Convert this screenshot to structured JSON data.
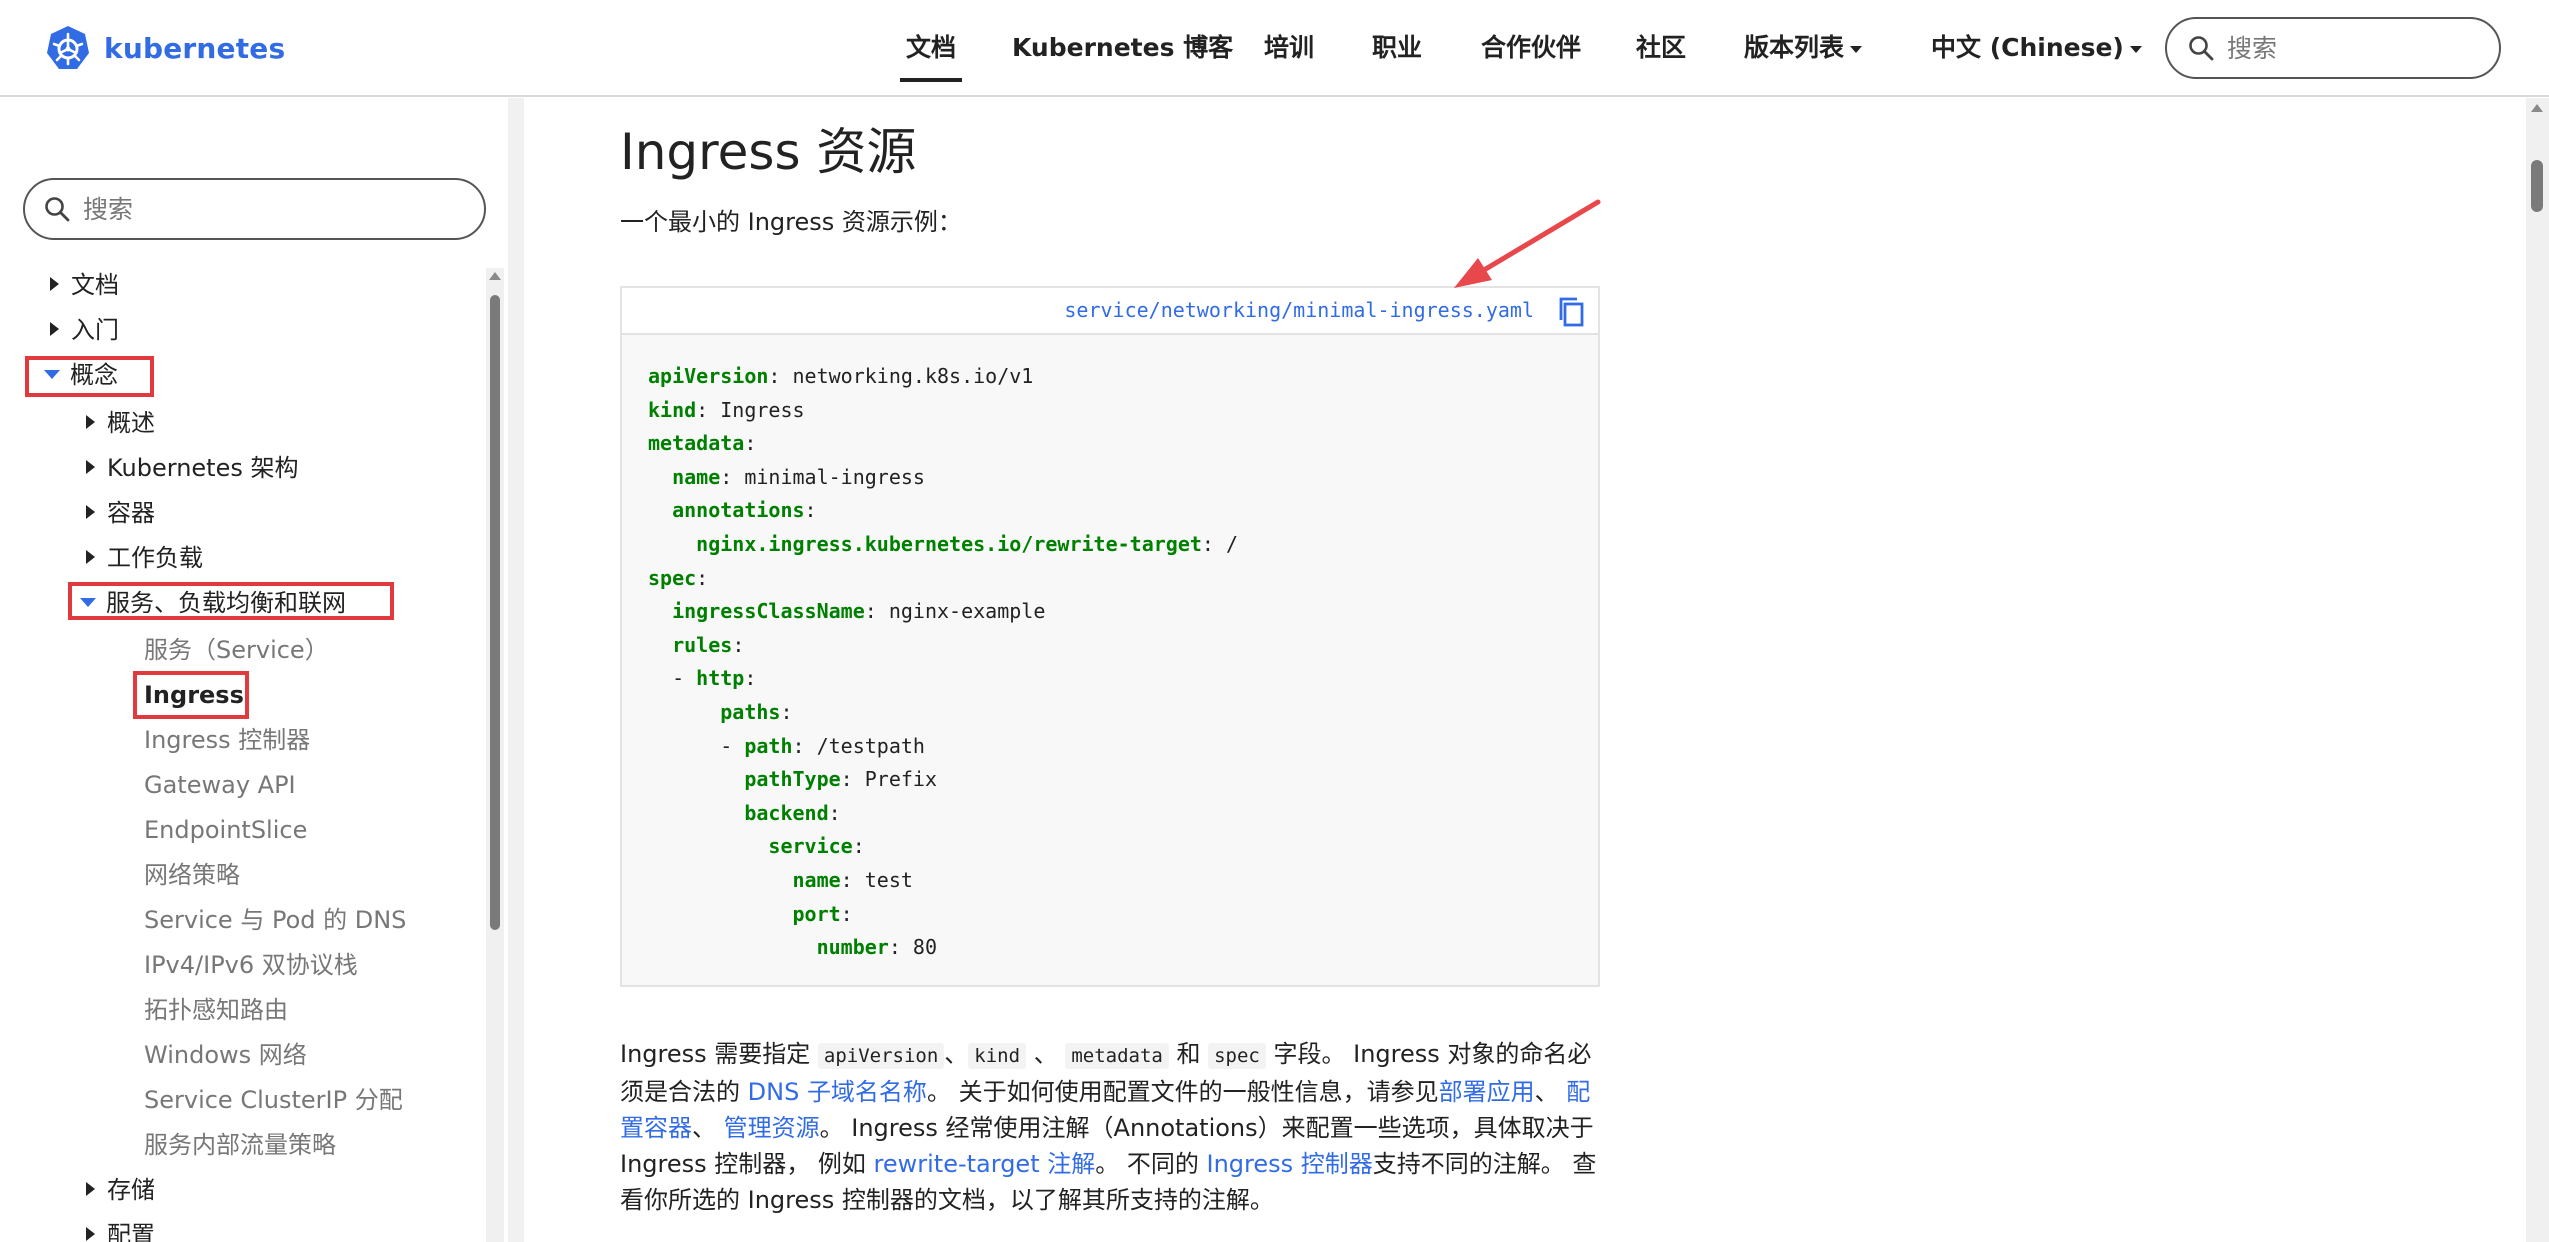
{
  "nav": {
    "brand": "kubernetes",
    "items": [
      {
        "label": "文档",
        "active": true
      },
      {
        "label": "Kubernetes 博客"
      },
      {
        "label": "培训"
      },
      {
        "label": "职业"
      },
      {
        "label": "合作伙伴"
      },
      {
        "label": "社区"
      },
      {
        "label": "版本列表",
        "dropdown": true
      },
      {
        "label": "中文 (Chinese)",
        "dropdown": true
      }
    ],
    "search_placeholder": "搜索"
  },
  "sidebar": {
    "search_placeholder": "搜索",
    "items": [
      {
        "label": "文档",
        "level": 0,
        "state": "collapsed"
      },
      {
        "label": "入门",
        "level": 0,
        "state": "collapsed"
      },
      {
        "label": "概念",
        "level": 0,
        "state": "expanded",
        "highlighted": true
      },
      {
        "label": "概述",
        "level": 1,
        "state": "collapsed"
      },
      {
        "label": "Kubernetes 架构",
        "level": 1,
        "state": "collapsed"
      },
      {
        "label": "容器",
        "level": 1,
        "state": "collapsed"
      },
      {
        "label": "工作负载",
        "level": 1,
        "state": "collapsed"
      },
      {
        "label": "服务、负载均衡和联网",
        "level": 1,
        "state": "expanded",
        "highlighted": true
      },
      {
        "label": "服务（Service）",
        "level": 2
      },
      {
        "label": "Ingress",
        "level": 2,
        "current": true,
        "highlighted": true
      },
      {
        "label": "Ingress 控制器",
        "level": 2
      },
      {
        "label": "Gateway API",
        "level": 2
      },
      {
        "label": "EndpointSlice",
        "level": 2
      },
      {
        "label": "网络策略",
        "level": 2
      },
      {
        "label": "Service 与 Pod 的 DNS",
        "level": 2
      },
      {
        "label": "IPv4/IPv6 双协议栈",
        "level": 2
      },
      {
        "label": "拓扑感知路由",
        "level": 2
      },
      {
        "label": "Windows 网络",
        "level": 2
      },
      {
        "label": "Service ClusterIP 分配",
        "level": 2
      },
      {
        "label": "服务内部流量策略",
        "level": 2
      },
      {
        "label": "存储",
        "level": 1,
        "state": "collapsed"
      },
      {
        "label": "配置",
        "level": 1,
        "state": "collapsed"
      }
    ]
  },
  "main": {
    "title": "Ingress 资源",
    "intro": "一个最小的 Ingress 资源示例：",
    "code": {
      "filename": "service/networking/minimal-ingress.yaml",
      "lines": [
        {
          "indent": "",
          "key": "apiVersion",
          "value": " networking.k8s.io/v1"
        },
        {
          "indent": "",
          "key": "kind",
          "value": " Ingress"
        },
        {
          "indent": "",
          "key": "metadata",
          "value": ""
        },
        {
          "indent": "  ",
          "key": "name",
          "value": " minimal-ingress"
        },
        {
          "indent": "  ",
          "key": "annotations",
          "value": ""
        },
        {
          "indent": "    ",
          "key": "nginx.ingress.kubernetes.io/rewrite-target",
          "value": " /"
        },
        {
          "indent": "",
          "key": "spec",
          "value": ""
        },
        {
          "indent": "  ",
          "key": "ingressClassName",
          "value": " nginx-example"
        },
        {
          "indent": "  ",
          "key": "rules",
          "value": ""
        },
        {
          "indent": "  - ",
          "key": "http",
          "value": ""
        },
        {
          "indent": "      ",
          "key": "paths",
          "value": ""
        },
        {
          "indent": "      - ",
          "key": "path",
          "value": " /testpath"
        },
        {
          "indent": "        ",
          "key": "pathType",
          "value": " Prefix"
        },
        {
          "indent": "        ",
          "key": "backend",
          "value": ""
        },
        {
          "indent": "          ",
          "key": "service",
          "value": ""
        },
        {
          "indent": "            ",
          "key": "name",
          "value": " test"
        },
        {
          "indent": "            ",
          "key": "port",
          "value": ""
        },
        {
          "indent": "              ",
          "key": "number",
          "value": " 80"
        }
      ]
    },
    "paragraph": {
      "t1": "Ingress 需要指定 ",
      "c1": "apiVersion",
      "t2": "、",
      "c2": "kind",
      "t3": " 、 ",
      "c3": "metadata",
      "t4": " 和 ",
      "c4": "spec",
      "t5": " 字段。 Ingress 对象的命名必须是合法的 ",
      "l1": "DNS 子域名名称",
      "t6": "。 关于如何使用配置文件的一般性信息，请参见",
      "l2": "部署应用",
      "t7": "、 ",
      "l3": "配置容器",
      "t8": "、 ",
      "l4": "管理资源",
      "t9": "。 Ingress 经常使用注解（Annotations）来配置一些选项，具体取决于 Ingress 控制器， 例如 ",
      "l5": "rewrite-target 注解",
      "t10": "。 不同的 ",
      "l6": "Ingress 控制器",
      "t11": "支持不同的注解。 查看你所选的 Ingress 控制器的文档，以了解其所支持的注解。"
    }
  },
  "colors": {
    "brand": "#326ce5",
    "highlight_box": "#e03a3e",
    "arrow": "#e8474b",
    "yaml_key": "#008000"
  }
}
